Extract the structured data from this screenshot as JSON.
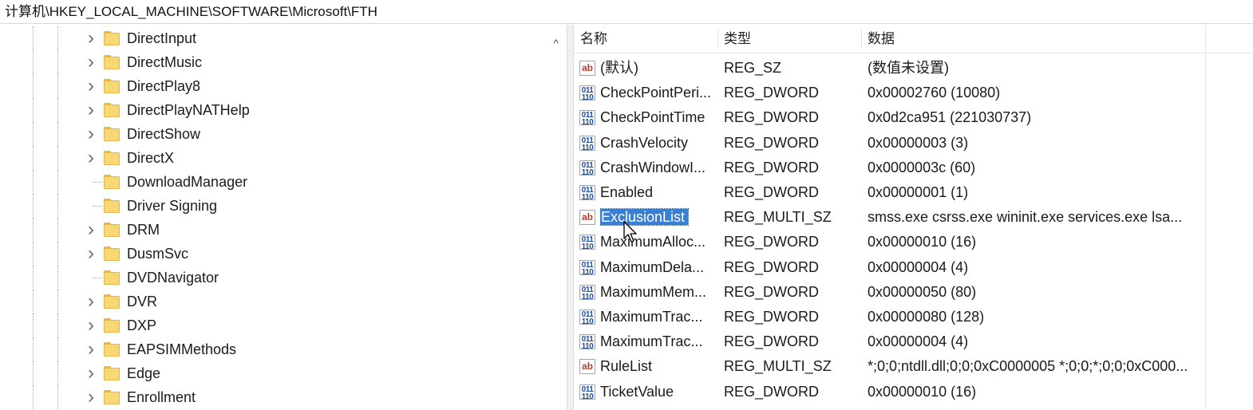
{
  "address": {
    "path": "计算机\\HKEY_LOCAL_MACHINE\\SOFTWARE\\Microsoft\\FTH"
  },
  "tree": {
    "items": [
      {
        "label": "DirectInput",
        "expandable": true
      },
      {
        "label": "DirectMusic",
        "expandable": true
      },
      {
        "label": "DirectPlay8",
        "expandable": true
      },
      {
        "label": "DirectPlayNATHelp",
        "expandable": true
      },
      {
        "label": "DirectShow",
        "expandable": true
      },
      {
        "label": "DirectX",
        "expandable": true
      },
      {
        "label": "DownloadManager",
        "expandable": false
      },
      {
        "label": "Driver Signing",
        "expandable": false
      },
      {
        "label": "DRM",
        "expandable": true
      },
      {
        "label": "DusmSvc",
        "expandable": true
      },
      {
        "label": "DVDNavigator",
        "expandable": false
      },
      {
        "label": "DVR",
        "expandable": true
      },
      {
        "label": "DXP",
        "expandable": true
      },
      {
        "label": "EAPSIMMethods",
        "expandable": true
      },
      {
        "label": "Edge",
        "expandable": true
      },
      {
        "label": "Enrollment",
        "expandable": true
      }
    ],
    "scroll_up_glyph": "^"
  },
  "list": {
    "columns": {
      "name": "名称",
      "type": "类型",
      "data": "数据"
    },
    "rows": [
      {
        "icon": "string-value-icon",
        "icon_text": "ab",
        "name": "(默认)",
        "type": "REG_SZ",
        "data": "(数值未设置)"
      },
      {
        "icon": "binary-value-icon",
        "icon_text": "011\n110",
        "name": "CheckPointPeri...",
        "type": "REG_DWORD",
        "data": "0x00002760 (10080)"
      },
      {
        "icon": "binary-value-icon",
        "icon_text": "011\n110",
        "name": "CheckPointTime",
        "type": "REG_DWORD",
        "data": "0x0d2ca951 (221030737)"
      },
      {
        "icon": "binary-value-icon",
        "icon_text": "011\n110",
        "name": "CrashVelocity",
        "type": "REG_DWORD",
        "data": "0x00000003 (3)"
      },
      {
        "icon": "binary-value-icon",
        "icon_text": "011\n110",
        "name": "CrashWindowI...",
        "type": "REG_DWORD",
        "data": "0x0000003c (60)"
      },
      {
        "icon": "binary-value-icon",
        "icon_text": "011\n110",
        "name": "Enabled",
        "type": "REG_DWORD",
        "data": "0x00000001 (1)"
      },
      {
        "icon": "string-value-icon",
        "icon_text": "ab",
        "name": "ExclusionList",
        "type": "REG_MULTI_SZ",
        "data": "smss.exe csrss.exe wininit.exe services.exe lsa...",
        "selected": true
      },
      {
        "icon": "binary-value-icon",
        "icon_text": "011\n110",
        "name": "MaximumAlloc...",
        "type": "REG_DWORD",
        "data": "0x00000010 (16)"
      },
      {
        "icon": "binary-value-icon",
        "icon_text": "011\n110",
        "name": "MaximumDela...",
        "type": "REG_DWORD",
        "data": "0x00000004 (4)"
      },
      {
        "icon": "binary-value-icon",
        "icon_text": "011\n110",
        "name": "MaximumMem...",
        "type": "REG_DWORD",
        "data": "0x00000050 (80)"
      },
      {
        "icon": "binary-value-icon",
        "icon_text": "011\n110",
        "name": "MaximumTrac...",
        "type": "REG_DWORD",
        "data": "0x00000080 (128)"
      },
      {
        "icon": "binary-value-icon",
        "icon_text": "011\n110",
        "name": "MaximumTrac...",
        "type": "REG_DWORD",
        "data": "0x00000004 (4)"
      },
      {
        "icon": "string-value-icon",
        "icon_text": "ab",
        "name": "RuleList",
        "type": "REG_MULTI_SZ",
        "data": "*;0;0;ntdll.dll;0;0;0xC0000005 *;0;0;*;0;0;0xC000..."
      },
      {
        "icon": "binary-value-icon",
        "icon_text": "011\n110",
        "name": "TicketValue",
        "type": "REG_DWORD",
        "data": "0x00000010 (16)"
      }
    ]
  },
  "colors": {
    "selection": "#3a7fd1",
    "folder": "#f8d775"
  }
}
